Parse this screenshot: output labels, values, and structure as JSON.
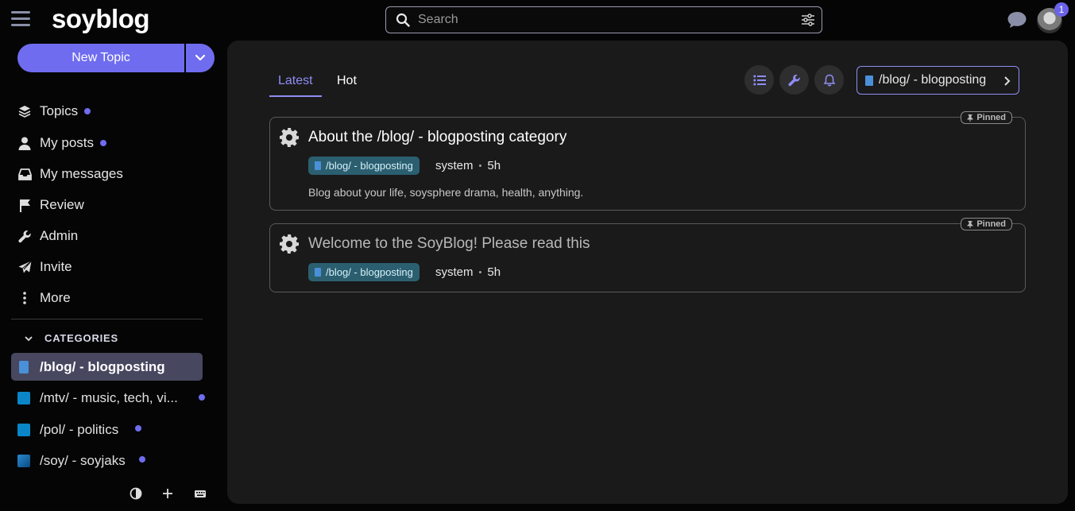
{
  "header": {
    "logo": "soyblog",
    "search_placeholder": "Search",
    "notification_count": "1"
  },
  "sidebar": {
    "new_topic_label": "New Topic",
    "nav": [
      {
        "label": "Topics",
        "icon": "layers-icon",
        "dot": true
      },
      {
        "label": "My posts",
        "icon": "user-icon",
        "dot": true
      },
      {
        "label": "My messages",
        "icon": "inbox-icon",
        "dot": false
      },
      {
        "label": "Review",
        "icon": "flag-icon",
        "dot": false
      },
      {
        "label": "Admin",
        "icon": "wrench-icon",
        "dot": false
      },
      {
        "label": "Invite",
        "icon": "paper-plane-icon",
        "dot": false
      },
      {
        "label": "More",
        "icon": "vertical-ellipsis-icon",
        "dot": false
      }
    ],
    "categories_header": "CATEGORIES",
    "categories": [
      {
        "label": "/blog/ - blogposting",
        "color": "#4a90d8",
        "active": true,
        "dot": false
      },
      {
        "label": "/mtv/ - music, tech, vi...",
        "color": "#0a86c8",
        "active": false,
        "dot": true
      },
      {
        "label": "/pol/ - politics",
        "color": "#0a86c8",
        "active": false,
        "dot": true
      },
      {
        "label": "/soy/ - soyjaks",
        "color": "#1a6fb0",
        "active": false,
        "dot": true
      }
    ]
  },
  "main": {
    "tabs": [
      {
        "label": "Latest",
        "active": true
      },
      {
        "label": "Hot",
        "active": false
      }
    ],
    "category_selector": "/blog/ - blogposting",
    "topics": [
      {
        "title": "About the /blog/ - blogposting category",
        "pinned_label": "Pinned",
        "category": "/blog/ - blogposting",
        "author": "system",
        "age": "5h",
        "excerpt": "Blog about your life, soysphere drama, health, anything."
      },
      {
        "title": "Welcome to the SoyBlog! Please read this",
        "pinned_label": "Pinned",
        "category": "/blog/ - blogposting",
        "author": "system",
        "age": "5h"
      }
    ]
  },
  "colors": {
    "accent": "#6f6cf0",
    "background": "#050505",
    "panel": "#1a1a1a",
    "badge": "#2b5f70"
  }
}
